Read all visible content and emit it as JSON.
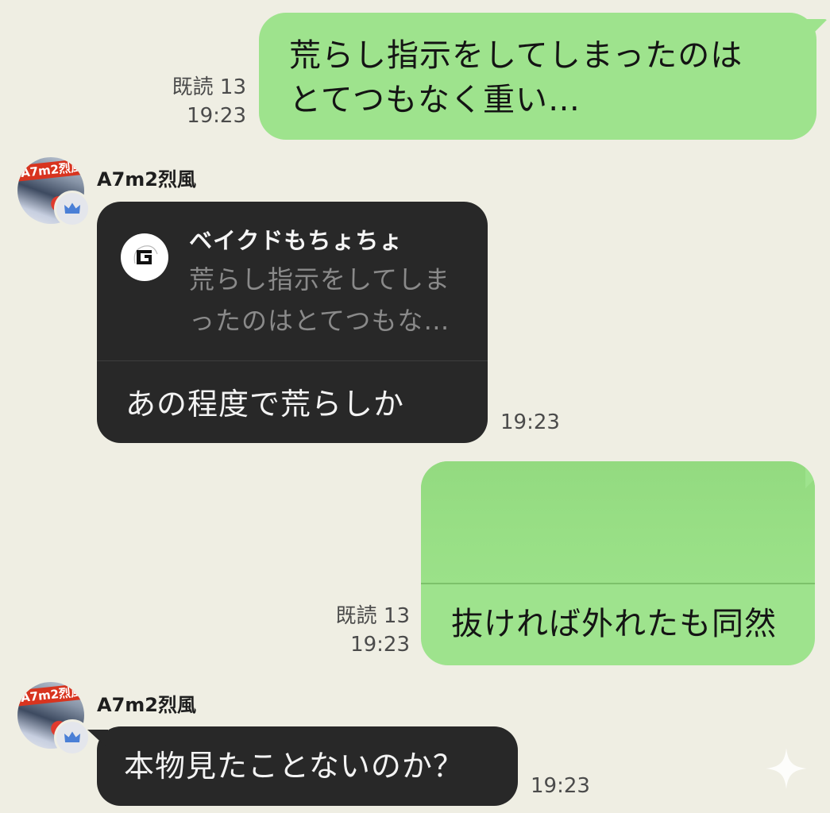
{
  "messages": [
    {
      "direction": "outgoing",
      "lines": [
        "荒らし指示をしてしまったのは",
        "とてつもなく重い…"
      ],
      "read": "既読 13",
      "time": "19:23"
    },
    {
      "direction": "incoming",
      "sender": "A7m2烈風",
      "reply_to": {
        "name": "ベイクドもちょちょ",
        "preview_lines": [
          "荒らし指示をしてしま",
          "ったのはとてつもな…"
        ]
      },
      "text": "あの程度で荒らしか",
      "time": "19:23"
    },
    {
      "direction": "outgoing",
      "text": "抜ければ外れたも同然",
      "read": "既読 13",
      "time": "19:23"
    },
    {
      "direction": "incoming",
      "sender": "A7m2烈風",
      "text": "本物見たことないのか？",
      "time": "19:23"
    }
  ],
  "colors": {
    "background": "#efeee3",
    "outgoing_bubble": "#9ee38d",
    "incoming_bubble": "#282828",
    "badge": "#4a7fd6"
  },
  "icons": {
    "avatar_badge": "crown-icon",
    "reply_avatar": "g-logo-icon",
    "corner": "sparkle-icon"
  }
}
